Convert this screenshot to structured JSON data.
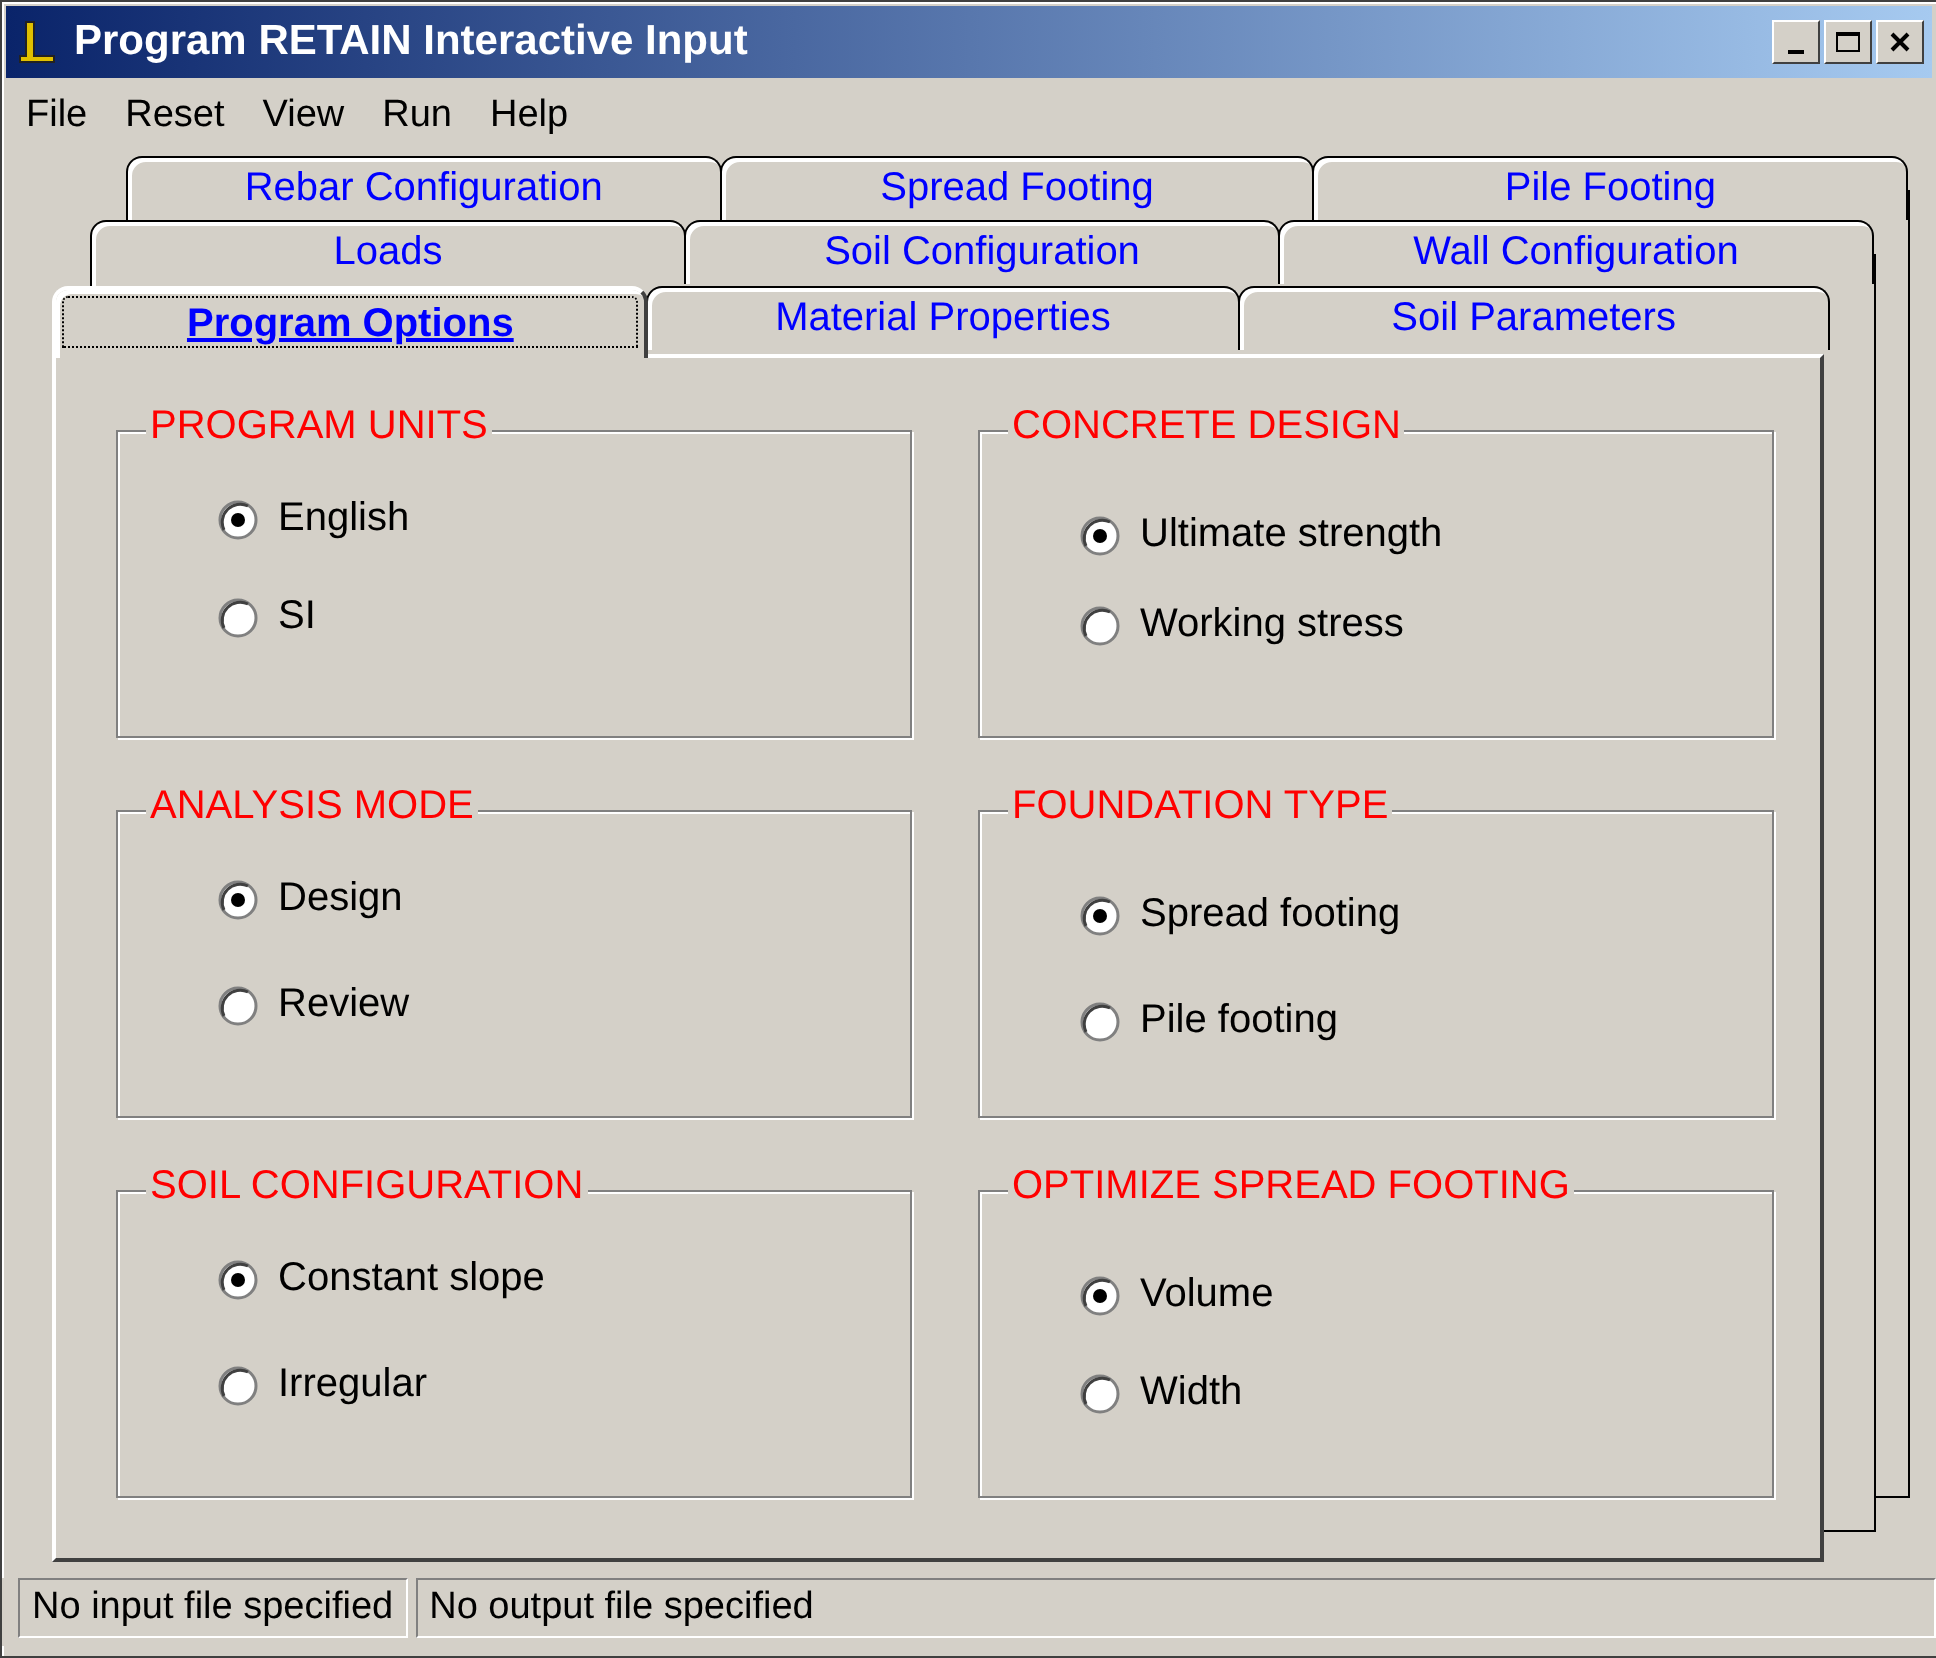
{
  "window": {
    "title": "Program RETAIN Interactive Input"
  },
  "menu": [
    "File",
    "Reset",
    "View",
    "Run",
    "Help"
  ],
  "tab_rows": [
    [
      {
        "label": "Rebar Configuration",
        "selected": false
      },
      {
        "label": "Spread Footing",
        "selected": false
      },
      {
        "label": "Pile Footing",
        "selected": false
      }
    ],
    [
      {
        "label": "Loads",
        "selected": false
      },
      {
        "label": "Soil Configuration",
        "selected": false
      },
      {
        "label": "Wall Configuration",
        "selected": false
      }
    ],
    [
      {
        "label": "Program Options",
        "selected": true
      },
      {
        "label": "Material Properties",
        "selected": false
      },
      {
        "label": "Soil Parameters",
        "selected": false
      }
    ]
  ],
  "groups": [
    {
      "title": "PROGRAM UNITS",
      "options": [
        {
          "label": "English",
          "selected": true
        },
        {
          "label": "SI",
          "selected": false
        }
      ]
    },
    {
      "title": "CONCRETE DESIGN",
      "options": [
        {
          "label": "Ultimate strength",
          "selected": true
        },
        {
          "label": "Working stress",
          "selected": false
        }
      ]
    },
    {
      "title": "ANALYSIS MODE",
      "options": [
        {
          "label": "Design",
          "selected": true
        },
        {
          "label": "Review",
          "selected": false
        }
      ]
    },
    {
      "title": "FOUNDATION TYPE",
      "options": [
        {
          "label": "Spread footing",
          "selected": true
        },
        {
          "label": "Pile footing",
          "selected": false
        }
      ]
    },
    {
      "title": "SOIL CONFIGURATION",
      "options": [
        {
          "label": "Constant slope",
          "selected": true
        },
        {
          "label": "Irregular",
          "selected": false
        }
      ]
    },
    {
      "title": "OPTIMIZE SPREAD FOOTING",
      "options": [
        {
          "label": "Volume",
          "selected": true
        },
        {
          "label": "Width",
          "selected": false
        }
      ]
    }
  ],
  "status_bar": [
    "No input file specified",
    "No output file specified"
  ]
}
